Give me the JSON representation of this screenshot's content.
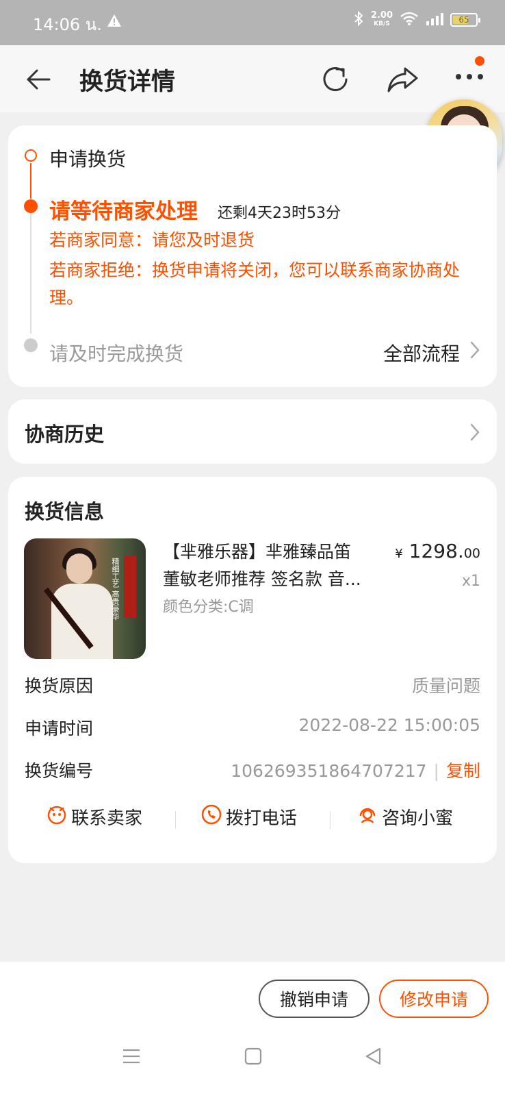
{
  "status_bar": {
    "time": "14:06 น.",
    "net_speed": "2.00",
    "net_unit": "KB/S",
    "battery": "65"
  },
  "header": {
    "title": "换货详情"
  },
  "progress": {
    "step1": "申请换货",
    "step2_title": "请等待商家处理",
    "step2_remaining": "还剩4天23时53分",
    "note_agree": "若商家同意：请您及时退货",
    "note_reject": "若商家拒绝：换货申请将关闭，您可以联系商家协商处理。",
    "step3": "请及时完成换货",
    "all_flow": "全部流程"
  },
  "history": {
    "label": "协商历史"
  },
  "exchange": {
    "label": "换货信息",
    "product": {
      "title_line1": "【芈雅乐器】芈雅臻品笛",
      "title_line2": "董敏老师推荐 签名款 音...",
      "sku": "颜色分类:C调",
      "price_symbol": "¥",
      "price_int": "1298.",
      "price_dec": "00",
      "quantity": "x1",
      "image_caption": "精细工艺 高贵豪华"
    },
    "reason_label": "换货原因",
    "reason_value": "质量问题",
    "time_label": "申请时间",
    "time_value": "2022-08-22 15:00:05",
    "id_label": "换货编号",
    "id_value": "106269351864707217",
    "copy_label": "复制",
    "actions": {
      "contact_seller": "联系卖家",
      "call": "拨打电话",
      "ask_xiaomi": "咨询小蜜"
    }
  },
  "bottom": {
    "cancel_button": "撤销申请",
    "modify_button": "修改申请"
  },
  "colors": {
    "accent": "#ff5000",
    "muted": "#999999",
    "background": "#f0f0f0"
  }
}
